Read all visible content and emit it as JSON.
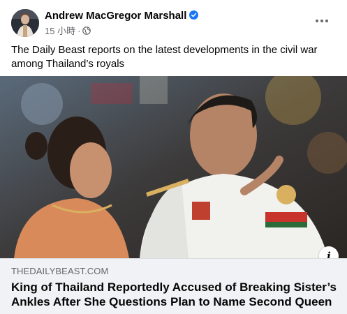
{
  "post": {
    "author_name": "Andrew MacGregor Marshall",
    "timestamp": "15 小時",
    "separator": "·",
    "text": "The Daily Beast reports on the latest developments in the civil war among Thailand’s royals"
  },
  "link_preview": {
    "domain": "THEDAILYBEAST.COM",
    "title": "King of Thailand Reportedly Accused of Breaking Sister’s Ankles After She Questions Plan to Name Second Queen",
    "info_label": "i"
  },
  "icons": {
    "verified": "verified-badge-icon",
    "audience": "globe-icon",
    "more": "more-options-icon"
  },
  "colors": {
    "verified": "#1877f2",
    "secondary_text": "#65676b",
    "preview_bg": "#f0f2f5"
  }
}
